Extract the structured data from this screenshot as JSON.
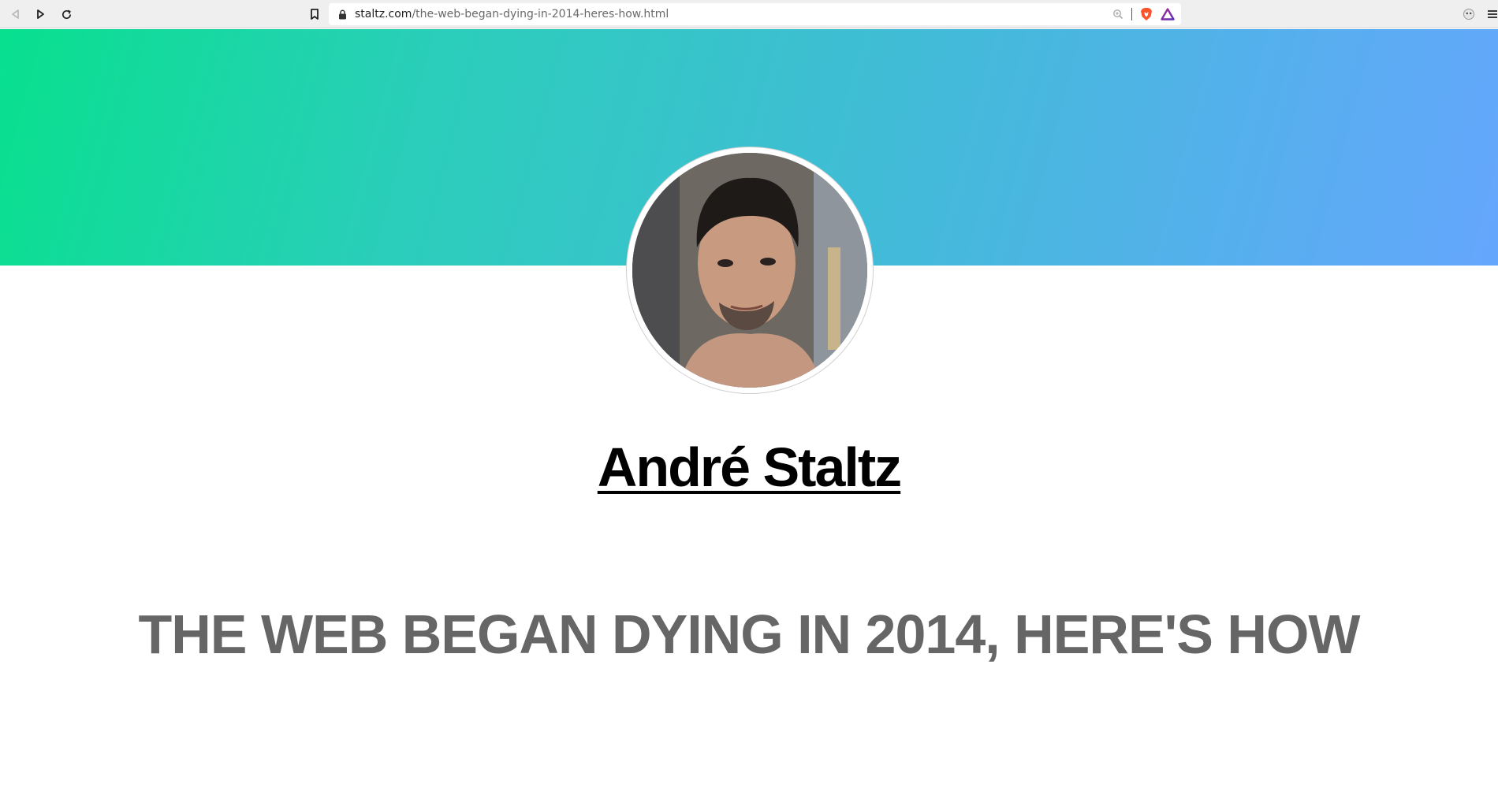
{
  "browser": {
    "url_domain": "staltz.com",
    "url_path": "/the-web-began-dying-in-2014-heres-how.html",
    "icons": {
      "back": "back-arrow-icon",
      "forward": "play-forward-icon",
      "reload": "reload-icon",
      "bookmark": "bookmark-icon",
      "lock": "lock-icon",
      "zoom": "zoom-icon",
      "brave_shield": "brave-lion-icon",
      "rewards": "brave-rewards-triangle-icon",
      "extension": "extension-icon",
      "menu": "hamburger-menu-icon"
    }
  },
  "page": {
    "author_name": "André Staltz",
    "post_title": "THE WEB BEGAN DYING IN 2014, HERE'S HOW",
    "colors": {
      "hero_start": "#08e08e",
      "hero_end": "#65a6fd",
      "title_color": "#666666",
      "name_color": "#000000"
    }
  }
}
